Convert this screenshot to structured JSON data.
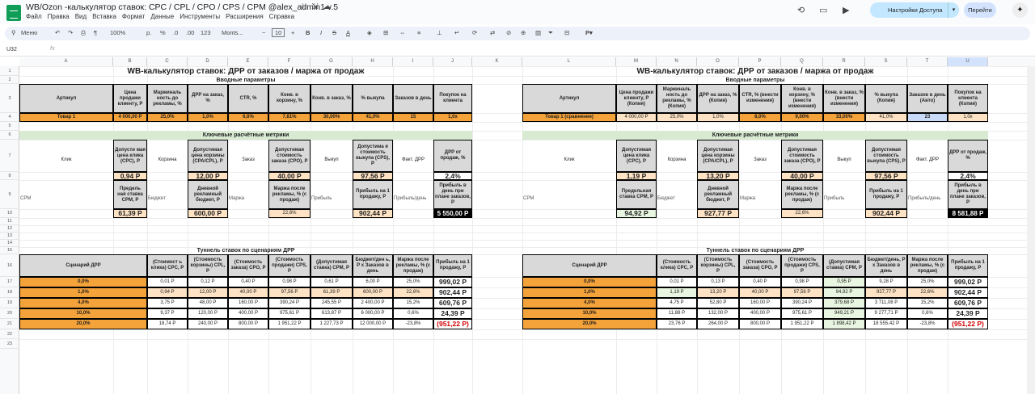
{
  "title": "WB/Ozon -калькулятор ставок: CPC / CPL / CPO / CPS / CPM @alex_admin1 v.5",
  "menu": [
    "Файл",
    "Правка",
    "Вид",
    "Вставка",
    "Формат",
    "Данные",
    "Инструменты",
    "Расширения",
    "Справка"
  ],
  "share_label": "Настройки Доступа",
  "go_label": "Перейти",
  "toolbar": {
    "search": "Меню",
    "zoom": "100%",
    "currency": "р.",
    "percent": "%",
    "dec1": ".0",
    "dec2": ".00",
    "num": "123",
    "font": "Monts...",
    "size": "10"
  },
  "namebox": "U32",
  "fx": "fx",
  "cols": [
    "A",
    "B",
    "C",
    "D",
    "E",
    "F",
    "G",
    "H",
    "I",
    "J",
    "K",
    "L",
    "M",
    "N",
    "O",
    "P",
    "Q",
    "R",
    "S",
    "T",
    "U"
  ],
  "rows": [
    "1",
    "2",
    "3",
    "4",
    "5",
    "6",
    "7",
    "8",
    "9",
    "10",
    "11",
    "12",
    "13",
    "14",
    "15",
    "16",
    "17",
    "18",
    "19",
    "20",
    "21",
    "22",
    "23"
  ],
  "left": {
    "title": "WB-калькулятор ставок: ДРР от заказов / маржа от продаж",
    "input_title": "Вводные параметры",
    "h": [
      "Артикул",
      "Цена продажи клиенту, Р",
      "Маржиналь ность до рекламы, %",
      "ДРР на заказ, %",
      "CTR, %",
      "Конв. в корзину, %",
      "Конв. в заказ, %",
      "% выкупа",
      "Заказов в день",
      "Покупок на клиента"
    ],
    "v": [
      "Товар 1",
      "4 000,00 Р",
      "25,0%",
      "1,0%",
      "6,6%",
      "7,81%",
      "30,00%",
      "41,0%",
      "15",
      "1,0x"
    ],
    "metrics_title": "Ключевые расчётные метрики",
    "m1": [
      "Клик",
      "Допусти мая цена клика (CPC), Р",
      "Корзина",
      "Допустимая цена корзины (CPA/CPL), Р",
      "Заказ",
      "Допустимая стоимость заказа (CPO), Р",
      "Выкуп",
      "Допустима я стоимость выкупа (CPS), Р",
      "Факт. ДРР",
      "ДРР от продаж, %"
    ],
    "m1v": [
      "0,94 Р",
      "12,00 Р",
      "40,00 Р",
      "97,56 Р",
      "2,4%"
    ],
    "m2": [
      "CPM",
      "Предель ная ставка CPM, Р",
      "Бюджет",
      "Дневной рекламный бюджет, Р",
      "Маржа",
      "Маржа после рекламы, % (с продаж)",
      "Прибыль",
      "Прибыль на 1 продажу, Р",
      "Прибыль/день",
      "Прибыль в день при плане заказов, Р"
    ],
    "m2v": [
      "61,39 Р",
      "600,00 Р",
      "22,6%",
      "902,44 Р",
      "5 550,00 Р"
    ],
    "tunnel_title": "Туннель ставок по сценариям ДРР",
    "th": [
      "Сценарий ДРР",
      "(Стоимост ь клика) CPC, Р",
      "(Стоимость корзины) CPL, Р",
      "(Стоимость заказа) CPO, Р",
      "(Стоимость продажи) CPS, Р",
      "(Допустимая ставка) CPM, Р",
      "Бюджет/ден ь, Р x Заказов в день",
      "Маржа после рекламы, % (с продаж)",
      "Прибыль на 1 продажу, Р"
    ],
    "tr": [
      [
        "0,0%",
        "0,01 Р",
        "0,12 Р",
        "0,40 Р",
        "0,98 Р",
        "0,61 Р",
        "6,00 Р",
        "25,0%",
        "999,02 Р"
      ],
      [
        "1,0%",
        "0,94 Р",
        "12,00 Р",
        "40,00 Р",
        "97,56 Р",
        "61,39 Р",
        "600,00 Р",
        "22,6%",
        "902,44 Р"
      ],
      [
        "4,0%",
        "3,75 Р",
        "48,00 Р",
        "160,00 Р",
        "390,24 Р",
        "245,55 Р",
        "2 400,00 Р",
        "15,2%",
        "609,76 Р"
      ],
      [
        "10,0%",
        "9,37 Р",
        "120,00 Р",
        "400,00 Р",
        "975,61 Р",
        "613,87 Р",
        "6 000,00 Р",
        "0,6%",
        "24,39 Р"
      ],
      [
        "20,0%",
        "18,74 Р",
        "240,00 Р",
        "800,00 Р",
        "1 951,22 Р",
        "1 227,73 Р",
        "12 000,00 Р",
        "-23,8%",
        "(951,22 Р)"
      ]
    ]
  },
  "right": {
    "title": "WB-калькулятор ставок: ДРР от заказов / маржа от продаж",
    "input_title": "Вводные параметры",
    "h": [
      "Артикул",
      "Цена продажи клиенту, Р (Копия)",
      "Маржиналь ность до рекламы, % (Копия)",
      "ДРР на заказ, % (Копия)",
      "CTR, % (внести изменения)",
      "Конв. в корзину, % (внести изменения)",
      "Конв. в заказ, % (внести изменения)",
      "% выкупа (Копия)",
      "Заказов в день (Авто)",
      "Покупок на клиента (Копия)"
    ],
    "v": [
      "Товар 1 (сравнение)",
      "4 000,00 Р",
      "25,0%",
      "1,0%",
      "8,0%",
      "9,00%",
      "33,00%",
      "41,0%",
      "23",
      "1,0x"
    ],
    "metrics_title": "Ключевые расчётные метрики",
    "m1": [
      "Клик",
      "Допустимая цена клика (CPC), Р",
      "Корзина",
      "Допустимая цена корзины (CPA/CPL), Р",
      "Заказ",
      "Допустимая стоимость заказа (CPO), Р",
      "Выкуп",
      "Допустимая стоимость выкупа (CPS), Р",
      "Факт. ДРР",
      "ДРР от продаж, %"
    ],
    "m1v": [
      "1,19 Р",
      "13,20 Р",
      "40,00 Р",
      "97,56 Р",
      "2,4%"
    ],
    "m2": [
      "CPM",
      "Предельная ставка CPM, Р",
      "Бюджет",
      "Дневной рекламный бюджет, Р",
      "Маржа",
      "Маржа после рекламы, % (с продаж)",
      "Прибыль",
      "Прибыль на 1 продажу, Р",
      "Прибыль/день",
      "Прибыль в день при плане заказов, Р"
    ],
    "m2v": [
      "94,92 Р",
      "927,77 Р",
      "22,6%",
      "902,44 Р",
      "8 581,88 Р"
    ],
    "tunnel_title": "Туннель ставок по сценариям ДРР",
    "th": [
      "Сценарий ДРР",
      "(Стоимость клика) CPC, Р",
      "(Стоимость корзины) CPL, Р",
      "(Стоимость заказа) CPO, Р",
      "(Стоимость продажи) CPS, Р",
      "(Допустимая ставка) CPM, Р",
      "Бюджет/день, Р x Заказов в день",
      "Маржа после рекламы, % (с продаж)",
      "Прибыль на 1 продажу, Р"
    ],
    "tr": [
      [
        "0,0%",
        "0,01 Р",
        "0,13 Р",
        "0,40 Р",
        "0,98 Р",
        "0,95 Р",
        "9,28 Р",
        "25,0%",
        "999,02 Р"
      ],
      [
        "1,0%",
        "1,19 Р",
        "13,20 Р",
        "40,00 Р",
        "97,56 Р",
        "94,92 Р",
        "927,77 Р",
        "22,6%",
        "902,44 Р"
      ],
      [
        "4,0%",
        "4,75 Р",
        "52,80 Р",
        "160,00 Р",
        "390,24 Р",
        "379,68 Р",
        "3 711,08 Р",
        "15,2%",
        "609,76 Р"
      ],
      [
        "10,0%",
        "11,88 Р",
        "132,00 Р",
        "400,00 Р",
        "975,61 Р",
        "949,21 Р",
        "9 277,71 Р",
        "0,6%",
        "24,39 Р"
      ],
      [
        "20,0%",
        "23,76 Р",
        "264,00 Р",
        "800,00 Р",
        "1 951,22 Р",
        "1 898,42 Р",
        "18 555,42 Р",
        "-23,8%",
        "(951,22 Р)"
      ]
    ]
  }
}
